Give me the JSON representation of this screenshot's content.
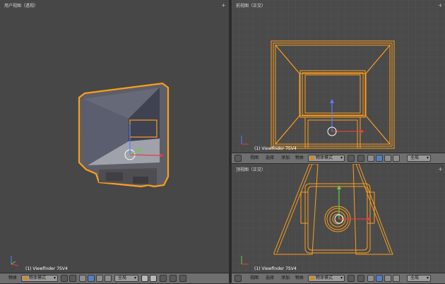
{
  "viewports": {
    "left": {
      "title": "用户视图（透视）",
      "object_label": "(1) Viewfinder 7SV4"
    },
    "top_right": {
      "title": "前视图（正交）",
      "object_label": "(1) Viewfinder 7SV4"
    },
    "bottom_right": {
      "title": "顶视图（正交）",
      "object_label": "(1) Viewfinder 7SV4"
    }
  },
  "headers": {
    "left": {
      "menu_object": "物体",
      "mode": "物体模式",
      "layer": "全局"
    },
    "top_right": {
      "menu_view": "视图",
      "menu_select": "选择",
      "menu_add": "添加",
      "menu_object": "物体",
      "mode": "物体模式",
      "layer": "全局"
    },
    "bottom_right": {
      "menu_view": "视图",
      "menu_select": "选择",
      "menu_add": "添加",
      "menu_object": "物体",
      "mode": "物体模式",
      "layer": "全局"
    }
  },
  "colors": {
    "selection": "#ff9e1a",
    "axis_x": "#e04040",
    "axis_y": "#60d040",
    "axis_z": "#5a7cff"
  }
}
